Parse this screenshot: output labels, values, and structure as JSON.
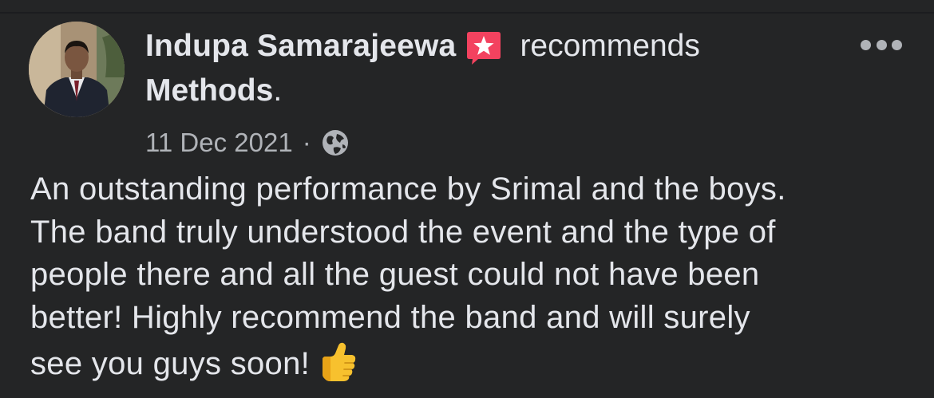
{
  "post": {
    "author": "Indupa Samarajeewa",
    "action": "recommends",
    "page_name": "Methods",
    "period": ".",
    "date": "11 Dec 2021",
    "separator": "·",
    "body_lines": [
      "An outstanding performance by Srimal and the boys.",
      "The band truly understood the event and the type of",
      "people there and all the guest could not have been",
      "better! Highly recommend the band and will surely",
      "see you guys soon!"
    ]
  },
  "icons": {
    "recommend": "star-speech-bubble-icon",
    "privacy": "globe-icon",
    "more": "more-options-icon",
    "emoji": "thumbs-up-emoji"
  },
  "colors": {
    "background": "#242526",
    "primary_text": "#e4e6eb",
    "secondary_text": "#b0b3b8",
    "recommend_badge": "#f3425f"
  }
}
